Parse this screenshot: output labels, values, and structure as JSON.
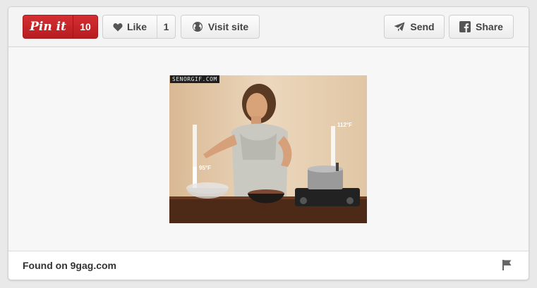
{
  "toolbar": {
    "pin_label": "Pin it",
    "pin_count": "10",
    "like_label": "Like",
    "like_count": "1",
    "visit_label": "Visit site",
    "send_label": "Send",
    "share_label": "Share"
  },
  "image": {
    "watermark": "SENORGIF.COM",
    "temp_high": "112°F",
    "temp_low": "95°F"
  },
  "footer": {
    "source": "Found on 9gag.com"
  },
  "colors": {
    "pin_red": "#c8262a",
    "card_bg": "#f7f7f7",
    "page_bg": "#e9e9e9"
  },
  "icons": [
    "heart-icon",
    "globe-icon",
    "send-plane-icon",
    "facebook-icon",
    "flag-icon"
  ]
}
